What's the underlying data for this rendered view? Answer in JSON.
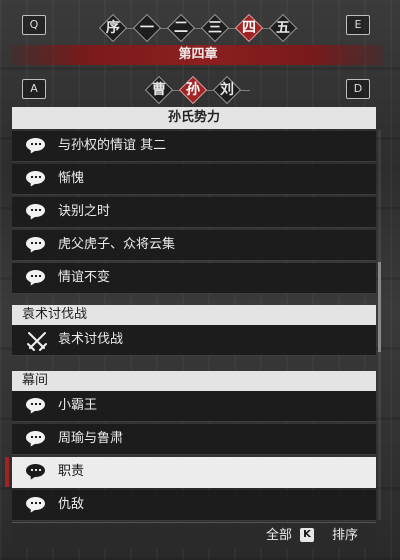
{
  "chapter_nav": {
    "key_left": "Q",
    "key_right": "E",
    "items": [
      "序",
      "一",
      "二",
      "三",
      "四",
      "五"
    ],
    "selected_index": 4
  },
  "chapter_title": "第四章",
  "faction_nav": {
    "key_left": "A",
    "key_right": "D",
    "items": [
      "曹",
      "孙",
      "刘"
    ],
    "selected_index": 1
  },
  "sections": [
    {
      "header": "孙氏势力",
      "items": [
        {
          "label": "与孙权的情谊 其二",
          "icon": "speech-bubble-icon"
        },
        {
          "label": "惭愧",
          "icon": "speech-bubble-icon"
        },
        {
          "label": "诀别之时",
          "icon": "speech-bubble-icon"
        },
        {
          "label": "虎父虎子、众将云集",
          "icon": "speech-bubble-icon"
        },
        {
          "label": "情谊不变",
          "icon": "speech-bubble-icon"
        }
      ]
    },
    {
      "header": "袁术讨伐战",
      "items": [
        {
          "label": "袁术讨伐战",
          "icon": "crossed-swords-icon"
        }
      ]
    },
    {
      "header": "幕间",
      "items": [
        {
          "label": "小霸王",
          "icon": "speech-bubble-icon"
        },
        {
          "label": "周瑜与鲁肃",
          "icon": "speech-bubble-icon"
        },
        {
          "label": "职责",
          "icon": "speech-bubble-icon",
          "selected": true
        },
        {
          "label": "仇敌",
          "icon": "speech-bubble-icon"
        }
      ]
    }
  ],
  "footer": {
    "all_label": "全部",
    "sort_key": "K",
    "sort_label": "排序"
  }
}
